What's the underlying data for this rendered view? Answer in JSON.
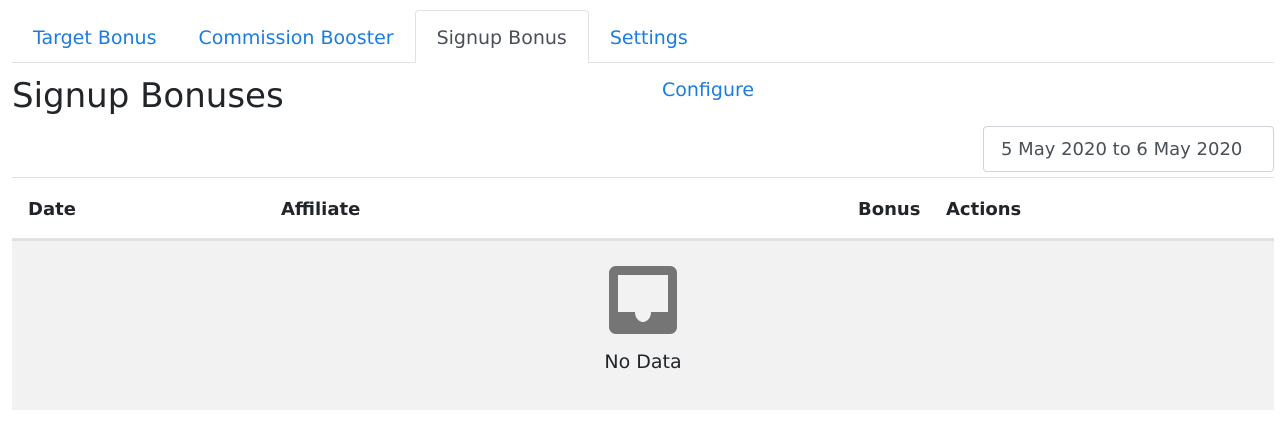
{
  "tabs": [
    {
      "label": "Target Bonus",
      "active": false
    },
    {
      "label": "Commission Booster",
      "active": false
    },
    {
      "label": "Signup Bonus",
      "active": true
    },
    {
      "label": "Settings",
      "active": false
    }
  ],
  "header": {
    "title": "Signup Bonuses",
    "configure_label": "Configure",
    "date_range": "5 May 2020 to 6 May 2020"
  },
  "table": {
    "columns": [
      "Date",
      "Affiliate",
      "Bonus",
      "Actions"
    ],
    "empty_icon": "inbox-icon",
    "empty_text": "No Data"
  },
  "colors": {
    "link": "#1a7ce0",
    "empty_background": "#f2f2f2",
    "icon": "#757575"
  }
}
